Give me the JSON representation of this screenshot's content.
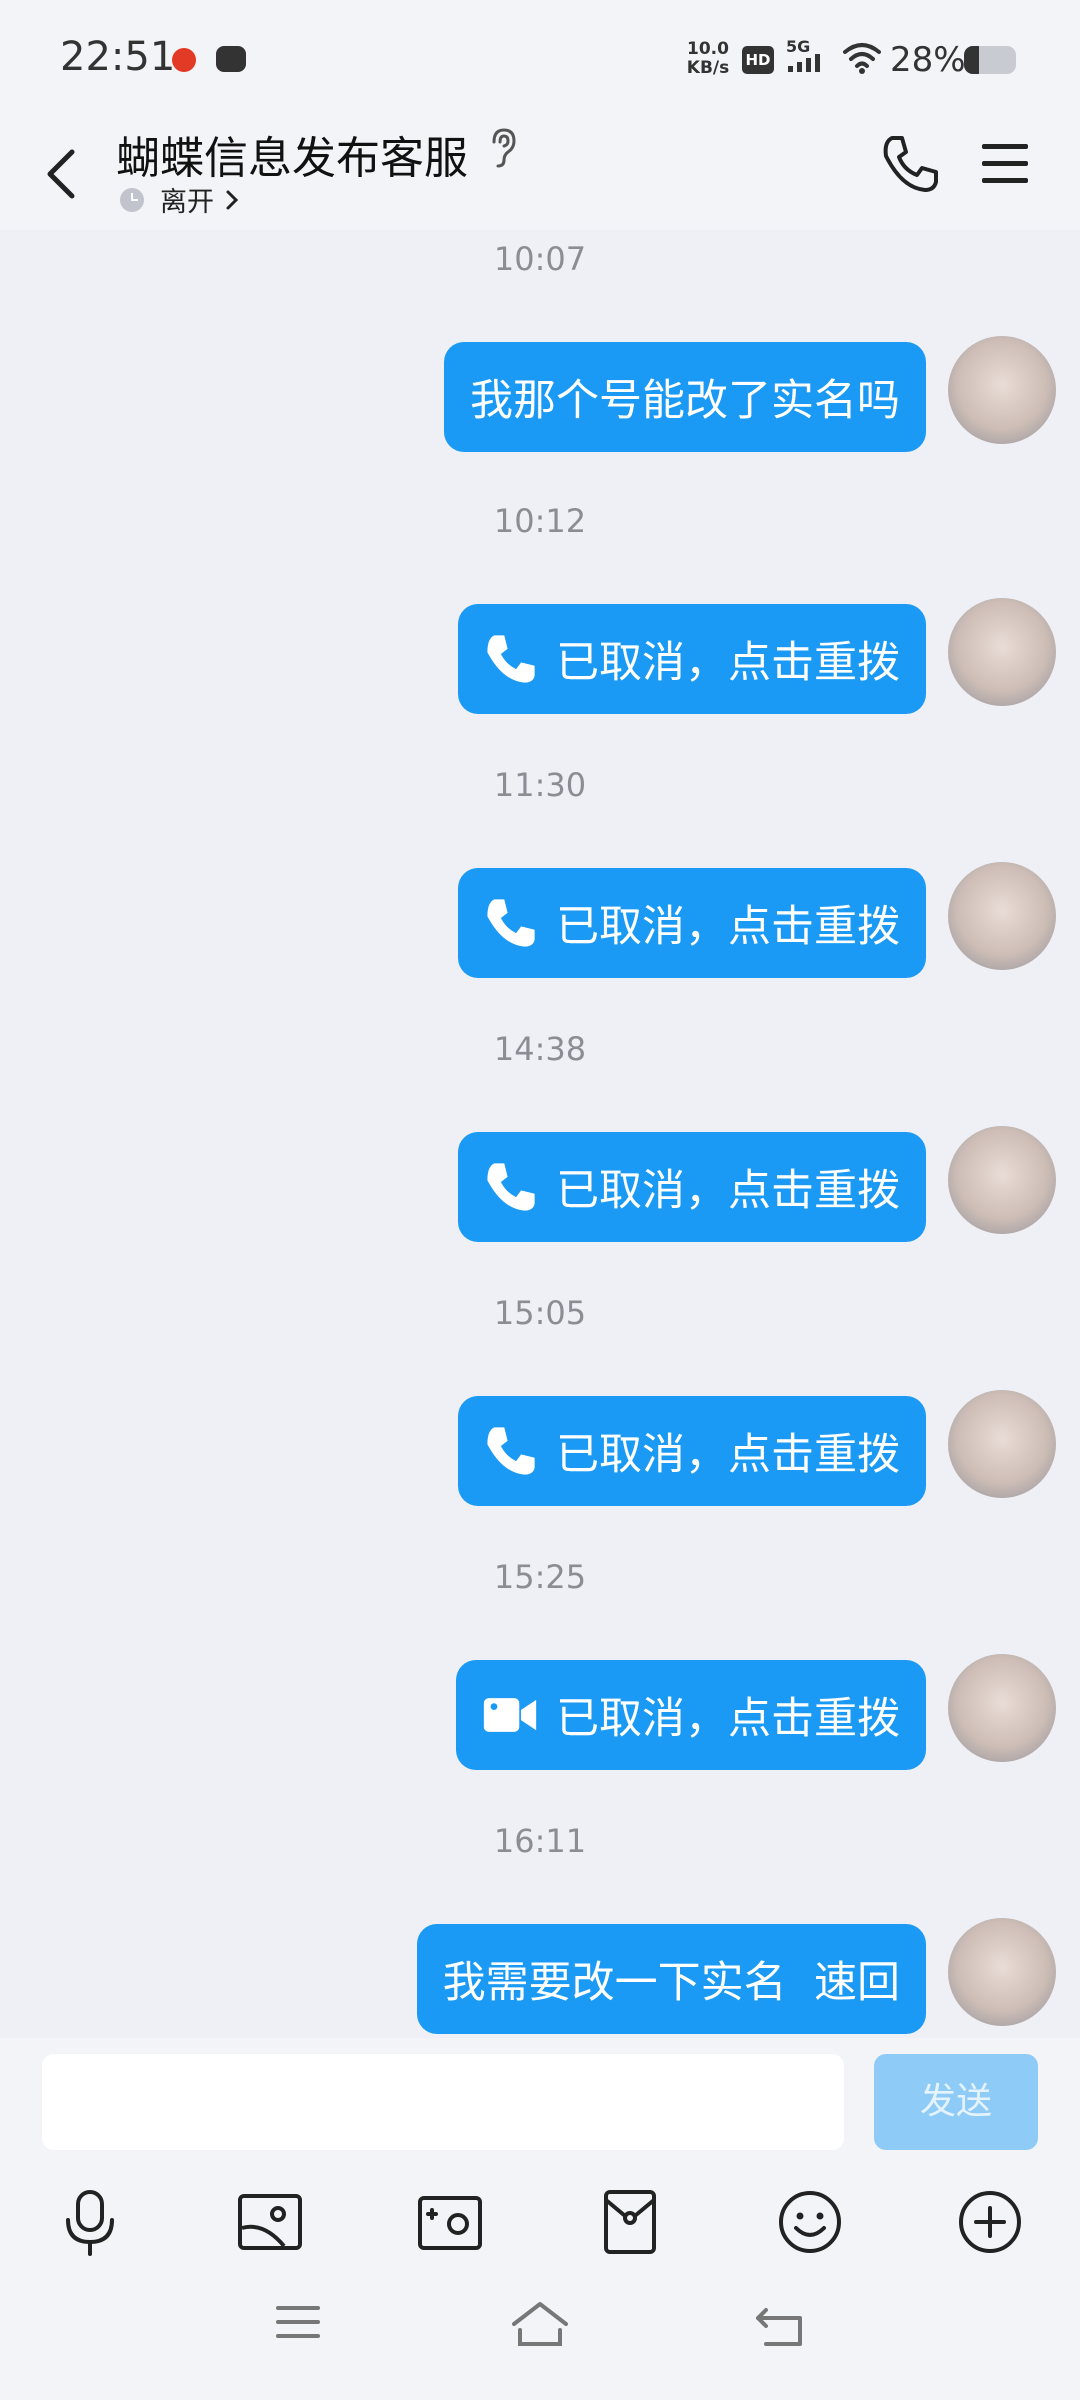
{
  "status_bar": {
    "time": "22:51",
    "net_speed_value": "10.0",
    "net_speed_unit": "KB/s",
    "hd_badge": "HD",
    "signal_label": "5G",
    "battery_text": "28%",
    "battery_level": 0.28
  },
  "header": {
    "title": "蝴蝶信息发布客服",
    "status": "离开"
  },
  "messages": [
    {
      "time": "10:07",
      "text": "我那个号能改了实名吗",
      "icon": "none"
    },
    {
      "time": "10:12",
      "text": "已取消，点击重拨",
      "icon": "phone-icon"
    },
    {
      "time": "11:30",
      "text": "已取消，点击重拨",
      "icon": "phone-icon"
    },
    {
      "time": "14:38",
      "text": "已取消，点击重拨",
      "icon": "phone-icon"
    },
    {
      "time": "15:05",
      "text": "已取消，点击重拨",
      "icon": "phone-icon"
    },
    {
      "time": "15:25",
      "text": "已取消，点击重拨",
      "icon": "video-camera-icon"
    },
    {
      "time": "16:11",
      "text": "我需要改一下实名  速回",
      "icon": "none"
    }
  ],
  "input": {
    "value": "",
    "send_label": "发送"
  },
  "colors": {
    "bubble": "#1a9af5",
    "send_disabled": "#8fcbf7",
    "background": "#eef0f6"
  },
  "toolbar_icons": [
    "microphone-icon",
    "image-icon",
    "camera-icon",
    "red-packet-icon",
    "emoji-icon",
    "plus-icon"
  ],
  "nav_icons": [
    "menu-icon",
    "home-icon",
    "back-icon"
  ]
}
